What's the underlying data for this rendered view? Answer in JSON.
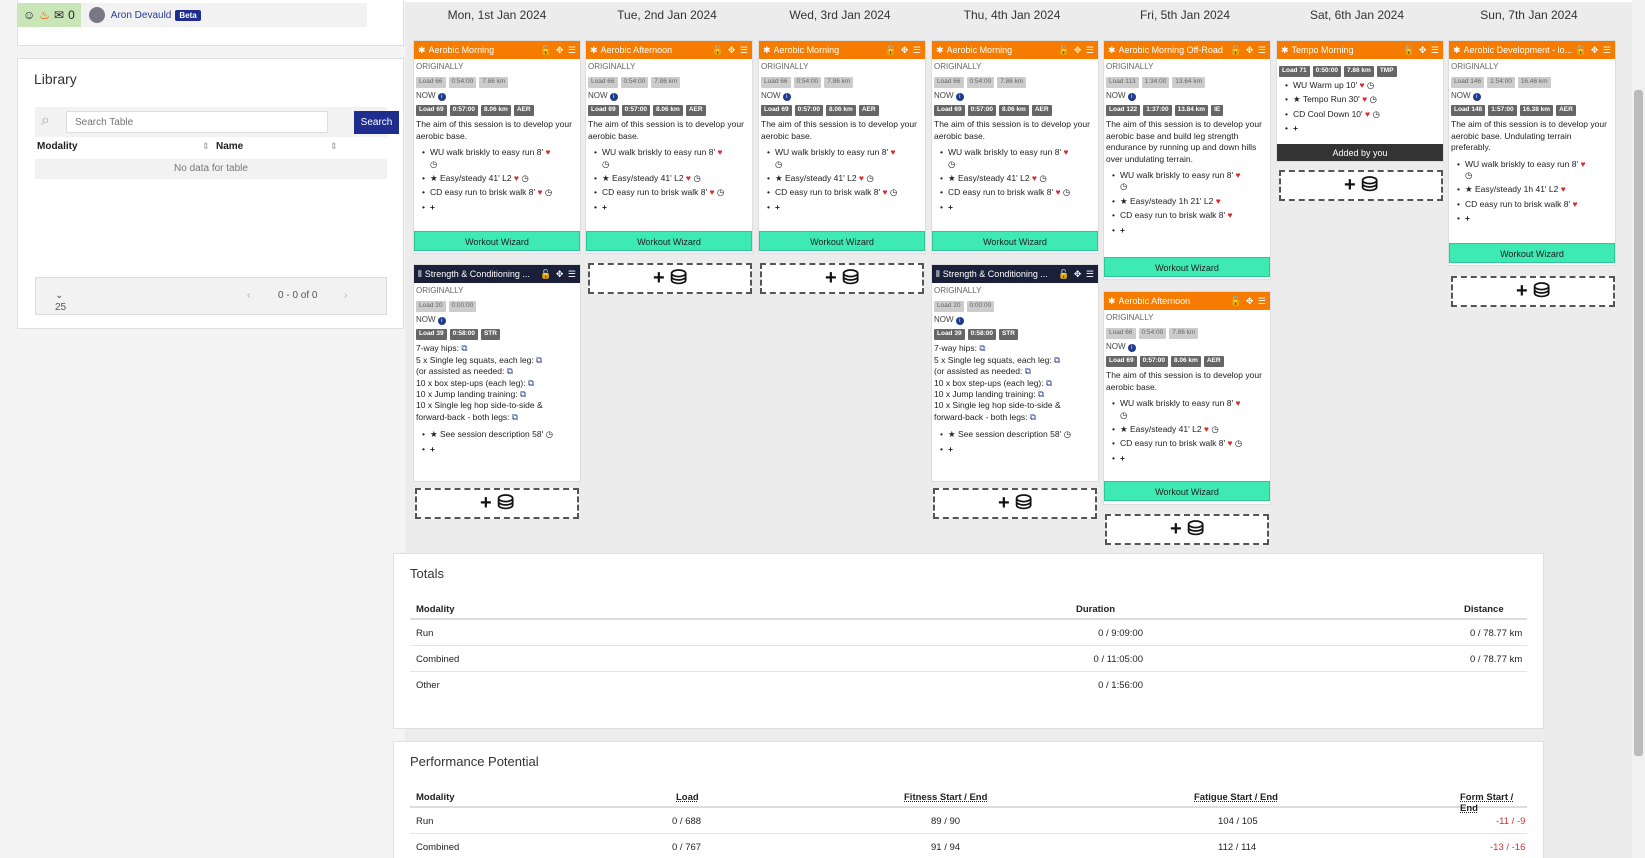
{
  "user": {
    "name": "Aron Devauld",
    "badge": "Beta",
    "count": "0"
  },
  "library": {
    "title": "Library",
    "search_placeholder": "Search Table",
    "search_button": "Search",
    "col_modality": "Modality",
    "col_name": "Name",
    "empty": "No data for table",
    "page_size": "25",
    "range": "0 - 0 of 0"
  },
  "days": [
    "Mon, 1st Jan 2024",
    "Tue, 2nd Jan 2024",
    "Wed, 3rd Jan 2024",
    "Thu, 4th Jan 2024",
    "Fri, 5th Jan 2024",
    "Sat, 6th Jan 2024",
    "Sun, 7th Jan 2024"
  ],
  "labels": {
    "originally": "ORIGINALLY",
    "now": "NOW",
    "wizard": "Workout Wizard",
    "added": "Added by you"
  },
  "cards": {
    "aero": {
      "title": "Aerobic Morning",
      "orig": [
        "Load 66",
        "0:54:00",
        "7.86 km"
      ],
      "now": [
        "Load 69",
        "0:57:00",
        "8.06 km",
        "AER"
      ],
      "desc": "The aim of this session is to develop your aerobic base.",
      "steps": [
        "WU walk briskly to easy run 8'",
        "Easy/steady 41' L2",
        "CD easy run to brisk walk 8'"
      ]
    },
    "aero_pm": {
      "title": "Aerobic Afternoon"
    },
    "offroad": {
      "title": "Aerobic Morning Off-Road",
      "orig": [
        "Load 113",
        "1:34:00",
        "13.64 km"
      ],
      "now": [
        "Load 122",
        "1:37:00",
        "13.84 km",
        "IE"
      ],
      "desc": "The aim of this session is to develop your aerobic base and build leg strength endurance by running up and down hills over undulating terrain.",
      "steps": [
        "WU walk briskly to easy run 8'",
        "Easy/steady 1h 21' L2",
        "CD easy run to brisk walk 8'"
      ]
    },
    "tempo": {
      "title": "Tempo Morning",
      "now": [
        "Load 71",
        "0:50:00",
        "7.86 km",
        "TMP"
      ],
      "steps": [
        "WU Warm up 10'",
        "Tempo Run 30'",
        "CD Cool Down 10'"
      ]
    },
    "dev": {
      "title": "Aerobic Development - lo...",
      "orig": [
        "Load 146",
        "1:54:00",
        "16.46 km"
      ],
      "now": [
        "Load 148",
        "1:57:00",
        "16.38 km",
        "AER"
      ],
      "desc": "The aim of this session is to develop your aerobic base. Undulating terrain preferably.",
      "steps": [
        "WU walk briskly to easy run 8'",
        "Easy/steady 1h 41' L2",
        "CD easy run to brisk walk 8'"
      ]
    },
    "str": {
      "title": "Strength & Conditioning ...",
      "orig": [
        "Load 20",
        "0:00:00"
      ],
      "now": [
        "Load 39",
        "0:58:00",
        "STR"
      ],
      "lines": [
        "7-way hips:",
        "5 x Single leg squats, each leg:",
        "(or assisted as needed:",
        "10 x box step-ups (each leg):",
        "10 x Jump landing training:",
        "10 x Single leg hop side-to-side &",
        "forward-back - both legs:"
      ],
      "step": "See session description 58'"
    }
  },
  "totals": {
    "title": "Totals",
    "headers": [
      "Modality",
      "Duration",
      "Distance"
    ],
    "rows": [
      [
        "Run",
        "0 / 9:09:00",
        "0 / 78.77 km"
      ],
      [
        "Combined",
        "0 / 11:05:00",
        "0 / 78.77 km"
      ],
      [
        "Other",
        "0 / 1:56:00",
        ""
      ]
    ]
  },
  "performance": {
    "title": "Performance Potential",
    "headers": [
      "Modality",
      "Load",
      "Fitness Start / End",
      "Fatigue Start / End",
      "Form Start / End"
    ],
    "rows": [
      [
        "Run",
        "0 / 688",
        "89 / 90",
        "104 / 105",
        "-11 / -9"
      ],
      [
        "Combined",
        "0 / 767",
        "91 / 94",
        "112 / 114",
        "-13 / -16"
      ]
    ]
  },
  "colors": {
    "orange": "#f57c00",
    "navy": "#1a1f3a",
    "wizard": "#3deab4",
    "brand": "#1f2d8f"
  }
}
